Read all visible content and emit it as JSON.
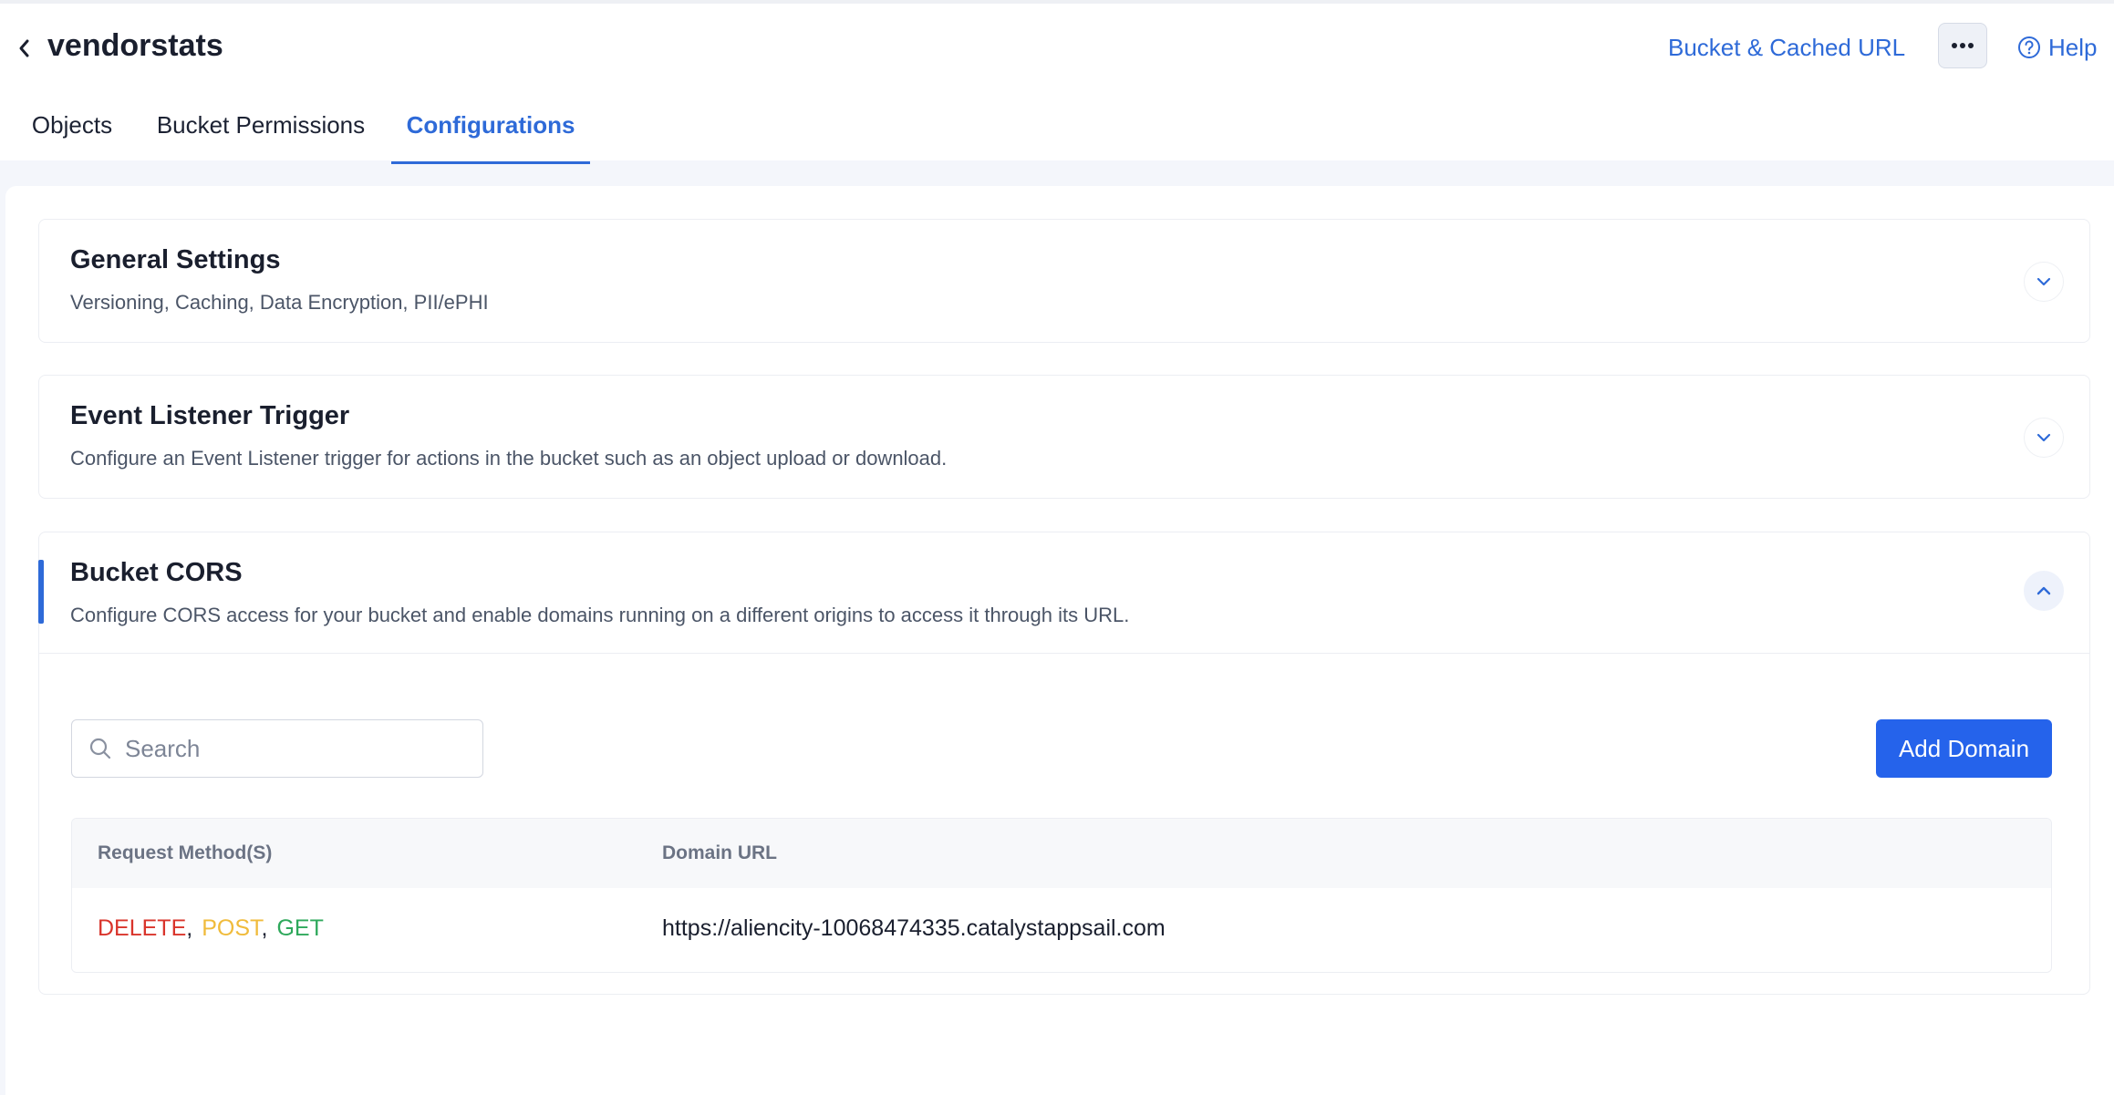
{
  "header": {
    "title": "vendorstats",
    "bucket_url_label": "Bucket & Cached URL",
    "more_label": "•••",
    "help_label": "Help"
  },
  "tabs": [
    {
      "label": "Objects",
      "active": false
    },
    {
      "label": "Bucket Permissions",
      "active": false
    },
    {
      "label": "Configurations",
      "active": true
    }
  ],
  "sections": {
    "general": {
      "title": "General Settings",
      "subtitle": "Versioning, Caching, Data Encryption, PII/ePHI",
      "expanded": false
    },
    "event": {
      "title": "Event Listener Trigger",
      "subtitle": "Configure an Event Listener trigger for actions in the bucket such as an object upload or download.",
      "expanded": false
    },
    "cors": {
      "title": "Bucket CORS",
      "subtitle": "Configure CORS access for your bucket and enable domains running on a different origins to access it through its URL.",
      "expanded": true,
      "search_placeholder": "Search",
      "add_button": "Add Domain",
      "columns": [
        "Request Method(S)",
        "Domain URL"
      ],
      "rows": [
        {
          "methods": [
            "DELETE",
            "POST",
            "GET"
          ],
          "separator": ",",
          "domain": "https://aliencity-10068474335.catalystappsail.com"
        }
      ]
    }
  },
  "colors": {
    "accent": "#2e6ad8",
    "button": "#2563eb",
    "delete": "#d9342b",
    "post": "#f0bb3b",
    "get": "#2ea85b"
  }
}
